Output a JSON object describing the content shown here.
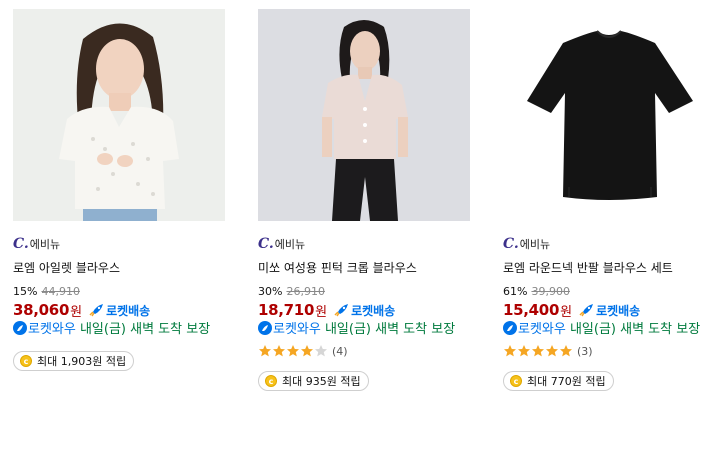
{
  "products": [
    {
      "brand_mark": "C.",
      "brand_name": "에비뉴",
      "title": "로엠 아일렛 블라우스",
      "discount": "15%",
      "original_price": "44,910",
      "price": "38,060",
      "currency": "원",
      "shipping_badge": "로켓배송",
      "delivery_label": "로켓와우",
      "delivery_text": " 내일(금) 새벽 도착 보장",
      "rating": null,
      "review_count": null,
      "points_label": "최대 1,903원 적립"
    },
    {
      "brand_mark": "C.",
      "brand_name": "에비뉴",
      "title": "미쏘 여성용 핀턱 크롭 블라우스",
      "discount": "30%",
      "original_price": "26,910",
      "price": "18,710",
      "currency": "원",
      "shipping_badge": "로켓배송",
      "delivery_label": "로켓와우",
      "delivery_text": " 내일(금) 새벽 도착 보장",
      "rating": 4,
      "review_count": "(4)",
      "points_label": "최대 935원 적립"
    },
    {
      "brand_mark": "C.",
      "brand_name": "에비뉴",
      "title": "로엠 라운드넥 반팔 블라우스 세트",
      "discount": "61%",
      "original_price": "39,900",
      "price": "15,400",
      "currency": "원",
      "shipping_badge": "로켓배송",
      "delivery_label": "로켓와우",
      "delivery_text": " 내일(금) 새벽 도착 보장",
      "rating": 5,
      "review_count": "(3)",
      "points_label": "최대 770원 적립"
    }
  ],
  "colors": {
    "price": "#ae0000",
    "rocket": "#0073e9",
    "delivery": "#007a3d",
    "star": "#f5a623",
    "coin": "#f7c21b"
  },
  "coin_symbol": "c"
}
